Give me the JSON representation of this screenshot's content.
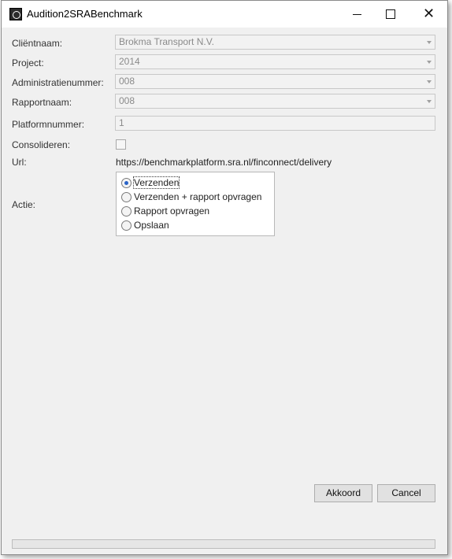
{
  "window": {
    "title": "Audition2SRABenchmark"
  },
  "fields": {
    "client": {
      "label": "Cliëntnaam:",
      "value": "Brokma Transport N.V."
    },
    "project": {
      "label": "Project:",
      "value": "2014"
    },
    "administration": {
      "label": "Administratienummer:",
      "value": "008"
    },
    "report": {
      "label": "Rapportnaam:",
      "value": "008"
    },
    "platform": {
      "label": "Platformnummer:",
      "value": "1"
    },
    "consolidate": {
      "label": "Consolideren:",
      "checked": false
    },
    "url": {
      "label": "Url:",
      "value": "https://benchmarkplatform.sra.nl/finconnect/delivery"
    }
  },
  "action": {
    "label": "Actie:",
    "selected": "Verzenden",
    "options": [
      "Verzenden",
      "Verzenden + rapport opvragen",
      "Rapport opvragen",
      "Opslaan"
    ]
  },
  "buttons": {
    "ok": "Akkoord",
    "cancel": "Cancel"
  },
  "progress": {
    "value": 0
  }
}
